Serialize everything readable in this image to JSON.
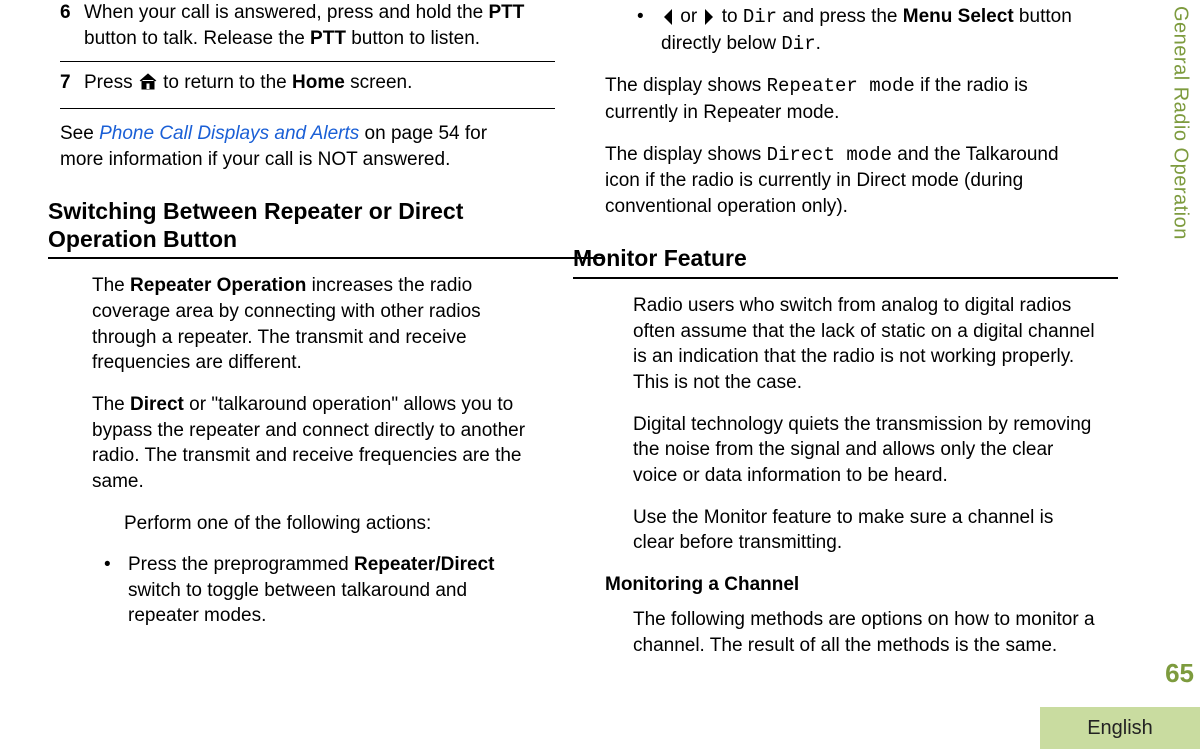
{
  "left": {
    "step6": {
      "num": "6",
      "text_before": "When your call is answered, press and hold the ",
      "ptt1": "PTT",
      "mid": " button to talk. Release the ",
      "ptt2": "PTT",
      "text_after": " button to listen."
    },
    "step7": {
      "num": "7",
      "before": "Press ",
      "after": " to return to the ",
      "home": "Home",
      "end": " screen."
    },
    "after": {
      "before": "See ",
      "link": "Phone Call Displays and Alerts",
      "after": " on page 54 for more information if your call is NOT answered."
    },
    "section_title": "Switching Between Repeater or Direct Operation Button",
    "p1": {
      "before": "The ",
      "b": "Repeater Operation",
      "after": " increases the radio coverage area by connecting with other radios through a repeater. The transmit and receive frequencies are different."
    },
    "p2": {
      "before": "The ",
      "b": "Direct",
      "after": " or \"talkaround operation\" allows you to bypass the repeater and connect directly to another radio. The transmit and receive frequencies are the same."
    },
    "p3": "Perform one of the following actions:",
    "bullet": {
      "dot": "•",
      "before": "Press the preprogrammed ",
      "b": "Repeater/Direct",
      "after": " switch to toggle between talkaround and repeater modes."
    }
  },
  "right": {
    "bullet": {
      "dot": "•",
      "mid_to": " or ",
      "mid_after": " to ",
      "dir": "Dir",
      "mid2": " and press the ",
      "b": "Menu Select",
      "mid3": " button directly below ",
      "dir2": "Dir",
      "end": "."
    },
    "p1": {
      "before": "The display shows ",
      "mono": "Repeater mode",
      "after": " if the radio is currently in Repeater mode."
    },
    "p2": {
      "before": "The display shows ",
      "mono": "Direct mode",
      "after": " and the Talkaround icon if the radio is currently in Direct mode (during conventional operation only)."
    },
    "section_title": "Monitor Feature",
    "p3": "Radio users who switch from analog to digital radios often assume that the lack of static on a digital channel is an indication that the radio is not working properly. This is not the case.",
    "p4": "Digital technology quiets the transmission by removing the noise from the signal and allows only the clear voice or data information to be heard.",
    "p5": "Use the Monitor feature to make sure a channel is clear before transmitting.",
    "subhead": "Monitoring a Channel",
    "p6": "The following methods are options on how to monitor a channel. The result of all the methods is the same."
  },
  "side": {
    "label": "General Radio Operation",
    "page_num": "65",
    "lang": "English"
  }
}
